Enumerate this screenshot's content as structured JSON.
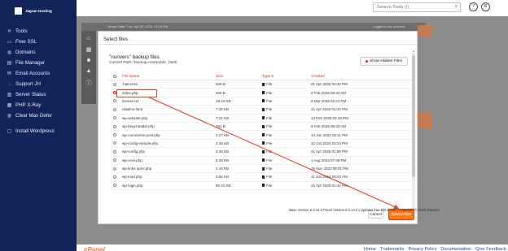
{
  "sidebar": {
    "logo_text": "Jagran Hosting",
    "items": [
      {
        "icon": "tools-icon",
        "glyph": "✕",
        "label": "Tools"
      },
      {
        "icon": "ssl-icon",
        "glyph": "▭",
        "label": "Free SSL"
      },
      {
        "icon": "globe-icon",
        "glyph": "◍",
        "label": "Domains"
      },
      {
        "icon": "file-manager-icon",
        "glyph": "▤",
        "label": "File Manager"
      },
      {
        "icon": "email-icon",
        "glyph": "✉",
        "label": "Email Accounts"
      },
      {
        "icon": "support-icon",
        "glyph": "◌",
        "label": "Support JH"
      },
      {
        "icon": "server-icon",
        "glyph": "▥",
        "label": "Server Status"
      },
      {
        "icon": "php-icon",
        "glyph": "▦",
        "label": "PHP X-Ray"
      },
      {
        "icon": "clear-icon",
        "glyph": "◍",
        "label": "Clear Max Defer"
      },
      {
        "icon": "wordpress-icon",
        "glyph": "▢",
        "label": "Install Wordpress"
      }
    ]
  },
  "header": {
    "search_placeholder": "Search Tools (/)",
    "btn1": "?",
    "btn2": "R"
  },
  "modal": {
    "title": "Select files",
    "backup_title": "\"nurivers\" backup files",
    "current_path": "Current Path: /backup-root/public_html/",
    "hidden_button": "Show Hidden Files",
    "columns": {
      "name": "File Name",
      "size": "Size",
      "type": "Type ▾",
      "date": "Created"
    },
    "rows": [
      {
        "name": ".htaccess",
        "size": "625 B",
        "type": "File",
        "date": "21 Apr 2025 01:33 PM",
        "checked": false
      },
      {
        "name": "index.php",
        "size": "405 B",
        "type": "File",
        "date": "8 Feb 2025 06:33 AM",
        "checked": true
      },
      {
        "name": "license.txt",
        "size": "19.44 KB",
        "type": "File",
        "date": "6 Mar 2025 02:24 PM",
        "checked": false
      },
      {
        "name": "readme.html",
        "size": "7.25 KB",
        "type": "File",
        "date": "21 Apr 2025 01:44 PM",
        "checked": false
      },
      {
        "name": "wp-activate.php",
        "size": "7.21 KB",
        "type": "File",
        "date": "13 Feb 2025 02:19 PM",
        "checked": false
      },
      {
        "name": "wp-blog-header.php",
        "size": "351 B",
        "type": "File",
        "date": "6 Feb 2025 06:33 AM",
        "checked": false
      },
      {
        "name": "wp-comments-post.php",
        "size": "2.27 KB",
        "type": "File",
        "date": "14 Jun 2023 02:11 PM",
        "checked": false
      },
      {
        "name": "wp-config-sample.php",
        "size": "3.26 KB",
        "type": "File",
        "date": "10 Oct 2024 03:24 PM",
        "checked": false
      },
      {
        "name": "wp-config.php",
        "size": "3.45 KB",
        "type": "File",
        "date": "21 Apr 2025 01:56 PM",
        "checked": false
      },
      {
        "name": "wp-cron.php",
        "size": "5.49 KB",
        "type": "File",
        "date": "1 Aug 2024 07:46 PM",
        "checked": false
      },
      {
        "name": "wp-links-opml.php",
        "size": "2.44 KB",
        "type": "File",
        "date": "26 Nov 2022 09:01 PM",
        "checked": false
      },
      {
        "name": "wp-load.php",
        "size": "3.84 KB",
        "type": "File",
        "date": "11 Jun 2024 09:23 AM",
        "checked": false
      },
      {
        "name": "wp-login.php",
        "size": "50.21 KB",
        "type": "File",
        "date": "21 Apr 2025 01:44 PM",
        "checked": false
      }
    ],
    "cancel": "Cancel",
    "select": "Select Files"
  },
  "background": {
    "server_line": "Server Date: Tue, Apr 22, 2025, 01:24 PM",
    "logged_in": "Logged in as: nurivers",
    "version_text": "Base Version 5.3.14.0 Panel Version 5.3.14.0 | Updates Tier RELEASE | Copyright © 2025 JabHost"
  },
  "footer": {
    "links": [
      "Home",
      "Trademarks",
      "Privacy Policy",
      "Documentation",
      "Give Feedback"
    ],
    "cpanel": "cPanel"
  },
  "colors": {
    "sidebar": "#12235a",
    "accent": "#ff7a1a",
    "annotation": "#e0412b"
  }
}
